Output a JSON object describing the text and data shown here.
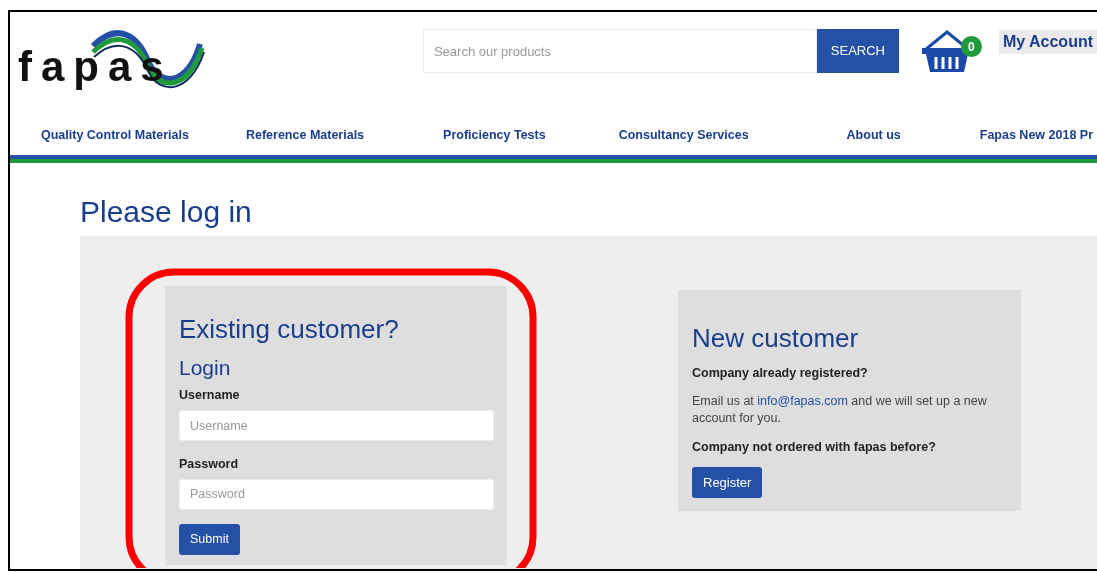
{
  "logo": {
    "text": "fapas"
  },
  "search": {
    "placeholder": "Search our products",
    "button": "SEARCH"
  },
  "cart": {
    "count": "0"
  },
  "account": {
    "label": "My Account"
  },
  "nav": [
    "Quality Control Materials",
    "Reference Materials",
    "Proficiency Tests",
    "Consultancy Services",
    "About us",
    "Fapas New 2018 Pr"
  ],
  "page_title": "Please log in",
  "login": {
    "heading": "Existing customer?",
    "subheading": "Login",
    "fields": [
      {
        "label": "Username",
        "placeholder": "Username"
      },
      {
        "label": "Password",
        "placeholder": "Password"
      }
    ],
    "submit": "Submit"
  },
  "new_customer": {
    "heading": "New customer",
    "question_1": "Company already registered?",
    "text_before": "Email us at",
    "link": "info@fapas.com",
    "text_after": "and we will set up a new account for you.",
    "question_2": "Company not ordered with fapas before?",
    "button": "Register"
  },
  "highlight": {
    "kind": "rounded-outline"
  }
}
